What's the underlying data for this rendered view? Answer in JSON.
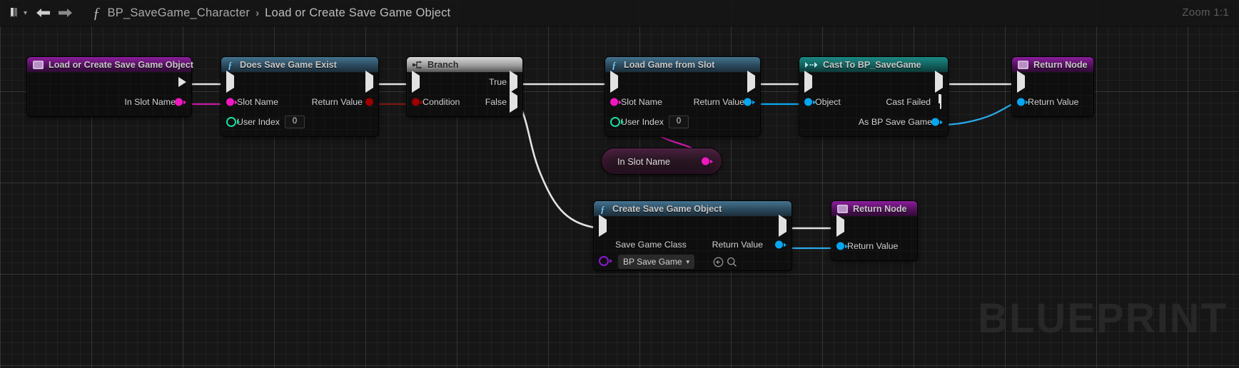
{
  "app": "Unreal Engine Blueprint Editor",
  "toolbar": {
    "bookmark_icon": "bookmark-icon",
    "dropdown_icon": "chevron-down-icon",
    "back_icon": "back-arrow-icon",
    "forward_icon": "forward-arrow-icon",
    "function_icon": "function-f-icon",
    "breadcrumb": [
      {
        "label": "BP_SaveGame_Character"
      },
      {
        "label": "Load or Create Save Game Object"
      }
    ],
    "breadcrumb_separator": "›",
    "zoom_label": "Zoom 1:1"
  },
  "watermark": "BLUEPRINT",
  "colors": {
    "exec_white": "#e2e2e2",
    "name_magenta": "#ef18c0",
    "bool_red": "#9c0000",
    "int_green": "#1ddca0",
    "object_blue": "#08a6ef",
    "class_purple": "#8a1ad4",
    "header_purple": "#8c1e9e",
    "header_blue": "#44738f",
    "header_teal": "#1b8a84",
    "header_gray": "#d8d8d8"
  },
  "nodes": [
    {
      "id": "entry",
      "title": "Load or Create Save Game Object",
      "icon": "function-entry-icon",
      "header_style": "purple",
      "outputs": [
        {
          "label": "",
          "type": "exec"
        },
        {
          "label": "In Slot Name",
          "type": "name"
        }
      ]
    },
    {
      "id": "does-save-game-exist",
      "title": "Does Save Game Exist",
      "icon": "function-f-icon",
      "header_style": "blue",
      "inputs": [
        {
          "label": "",
          "type": "exec"
        },
        {
          "label": "Slot Name",
          "type": "name"
        },
        {
          "label": "User Index",
          "type": "int",
          "value": "0"
        }
      ],
      "outputs": [
        {
          "label": "",
          "type": "exec"
        },
        {
          "label": "Return Value",
          "type": "bool"
        }
      ]
    },
    {
      "id": "branch",
      "title": "Branch",
      "icon": "branch-icon",
      "header_style": "gray",
      "inputs": [
        {
          "label": "",
          "type": "exec"
        },
        {
          "label": "Condition",
          "type": "bool"
        }
      ],
      "outputs": [
        {
          "label": "True",
          "type": "exec"
        },
        {
          "label": "False",
          "type": "exec"
        }
      ]
    },
    {
      "id": "load-game-from-slot",
      "title": "Load Game from Slot",
      "icon": "function-f-icon",
      "header_style": "blue",
      "inputs": [
        {
          "label": "",
          "type": "exec"
        },
        {
          "label": "Slot Name",
          "type": "name"
        },
        {
          "label": "User Index",
          "type": "int",
          "value": "0"
        }
      ],
      "outputs": [
        {
          "label": "",
          "type": "exec"
        },
        {
          "label": "Return Value",
          "type": "object"
        }
      ]
    },
    {
      "id": "cast-to-bp-savegame",
      "title": "Cast To BP_SaveGame",
      "icon": "cast-icon",
      "header_style": "teal",
      "inputs": [
        {
          "label": "",
          "type": "exec"
        },
        {
          "label": "Object",
          "type": "object"
        }
      ],
      "outputs": [
        {
          "label": "",
          "type": "exec"
        },
        {
          "label": "Cast Failed",
          "type": "exec-hollow"
        },
        {
          "label": "As BP Save Game",
          "type": "object"
        }
      ]
    },
    {
      "id": "return-node-top",
      "title": "Return Node",
      "icon": "function-result-icon",
      "header_style": "purple",
      "inputs": [
        {
          "label": "",
          "type": "exec"
        },
        {
          "label": "Return Value",
          "type": "object"
        }
      ]
    },
    {
      "id": "in-slot-name-getter",
      "title": "In Slot Name",
      "kind": "variable-getter",
      "outputs": [
        {
          "label": "",
          "type": "name"
        }
      ]
    },
    {
      "id": "create-save-game-object",
      "title": "Create Save Game Object",
      "icon": "function-f-icon",
      "header_style": "blue",
      "inputs": [
        {
          "label": "",
          "type": "exec"
        },
        {
          "label": "Save Game Class",
          "type": "class",
          "value": "BP Save Game",
          "reset_icon": "reset-arrow-icon",
          "browse_icon": "search-icon"
        }
      ],
      "outputs": [
        {
          "label": "",
          "type": "exec"
        },
        {
          "label": "Return Value",
          "type": "object"
        }
      ]
    },
    {
      "id": "return-node-bottom",
      "title": "Return Node",
      "icon": "function-result-icon",
      "header_style": "purple",
      "inputs": [
        {
          "label": "",
          "type": "exec"
        },
        {
          "label": "Return Value",
          "type": "object"
        }
      ]
    }
  ]
}
